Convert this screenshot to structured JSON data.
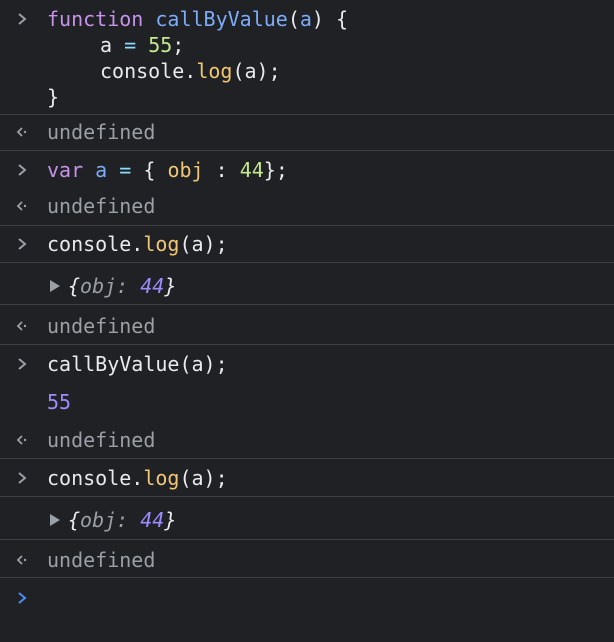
{
  "colors": {
    "background": "#202124",
    "separator": "#3c4043",
    "keyword": "#c792ea",
    "function_name": "#7cacf8",
    "number": "#c3e88d",
    "method": "#f0c674",
    "undefined": "#9aa0a6",
    "output_number": "#9a8cff",
    "prompt_active": "#4c8df6"
  },
  "entries": [
    {
      "kind": "input",
      "lines": [
        [
          "function",
          "callByValue",
          "(",
          "a",
          ")",
          " {"
        ],
        [
          "a",
          "=",
          "55",
          ";"
        ],
        [
          "console",
          ".",
          "log",
          "(a);"
        ],
        [
          "}"
        ]
      ]
    },
    {
      "kind": "result",
      "text": "undefined"
    },
    {
      "kind": "input",
      "tokens": [
        "var",
        "a",
        "=",
        "{ ",
        "obj",
        " : ",
        "44",
        "};"
      ]
    },
    {
      "kind": "result",
      "text": "undefined"
    },
    {
      "kind": "input",
      "tokens": [
        "console",
        ".",
        "log",
        "(a);"
      ]
    },
    {
      "kind": "log_object",
      "preview": {
        "open": "{",
        "key": "obj",
        "colon": ":",
        "value": "44",
        "close": "}"
      }
    },
    {
      "kind": "result",
      "text": "undefined"
    },
    {
      "kind": "input",
      "text": "callByValue(a);"
    },
    {
      "kind": "log_number",
      "text": "55"
    },
    {
      "kind": "result",
      "text": "undefined"
    },
    {
      "kind": "input",
      "tokens": [
        "console",
        ".",
        "log",
        "(a);"
      ]
    },
    {
      "kind": "log_object",
      "preview": {
        "open": "{",
        "key": "obj",
        "colon": ":",
        "value": "44",
        "close": "}"
      }
    },
    {
      "kind": "result",
      "text": "undefined"
    }
  ],
  "icons": {
    "input_prompt": "chevron-right-icon",
    "result_arrow": "return-arrow-icon",
    "expand": "triangle-right-icon",
    "active_prompt": "chevron-right-icon"
  }
}
